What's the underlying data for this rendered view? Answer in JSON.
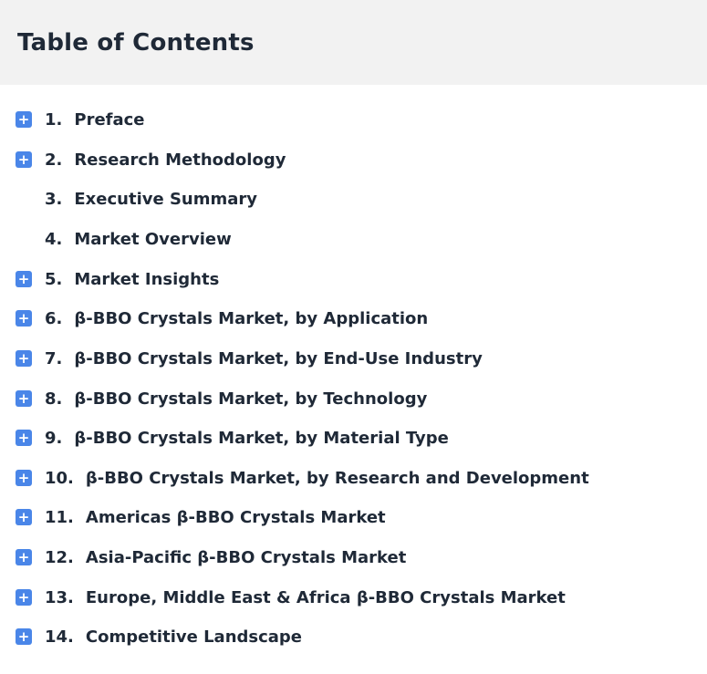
{
  "header": {
    "title": "Table of Contents"
  },
  "toc": {
    "items": [
      {
        "number": "1.",
        "label": "Preface",
        "expandable": true
      },
      {
        "number": "2.",
        "label": "Research Methodology",
        "expandable": true
      },
      {
        "number": "3.",
        "label": "Executive Summary",
        "expandable": false
      },
      {
        "number": "4.",
        "label": "Market Overview",
        "expandable": false
      },
      {
        "number": "5.",
        "label": "Market Insights",
        "expandable": true
      },
      {
        "number": "6.",
        "label": "β-BBO Crystals Market, by Application",
        "expandable": true
      },
      {
        "number": "7.",
        "label": "β-BBO Crystals Market, by End-Use Industry",
        "expandable": true
      },
      {
        "number": "8.",
        "label": "β-BBO Crystals Market, by Technology",
        "expandable": true
      },
      {
        "number": "9.",
        "label": "β-BBO Crystals Market, by Material Type",
        "expandable": true
      },
      {
        "number": "10.",
        "label": "β-BBO Crystals Market, by Research and Development",
        "expandable": true
      },
      {
        "number": "11.",
        "label": "Americas β-BBO Crystals Market",
        "expandable": true
      },
      {
        "number": "12.",
        "label": "Asia-Pacific β-BBO Crystals Market",
        "expandable": true
      },
      {
        "number": "13.",
        "label": "Europe, Middle East & Africa β-BBO Crystals Market",
        "expandable": true
      },
      {
        "number": "14.",
        "label": "Competitive Landscape",
        "expandable": true
      }
    ],
    "expand_symbol": "+",
    "icon_name": "plus-square-icon",
    "icon_color": "#4a86e8"
  }
}
